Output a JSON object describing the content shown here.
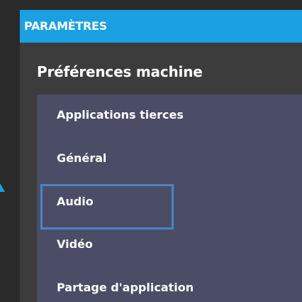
{
  "panel": {
    "title": "PARAMÈTRES",
    "section_title": "Préférences machine"
  },
  "menu": {
    "items": [
      {
        "label": "Applications tierces",
        "selected": false
      },
      {
        "label": "Général",
        "selected": false
      },
      {
        "label": "Audio",
        "selected": true
      },
      {
        "label": "Vidéo",
        "selected": false
      },
      {
        "label": "Partage d'application",
        "selected": false
      }
    ]
  },
  "colors": {
    "accent": "#1ba1e2",
    "panel_bg": "#3c3c3c",
    "menu_bg": "#4a4d65",
    "focus_border": "#4a84c9",
    "text": "#ffffff"
  }
}
